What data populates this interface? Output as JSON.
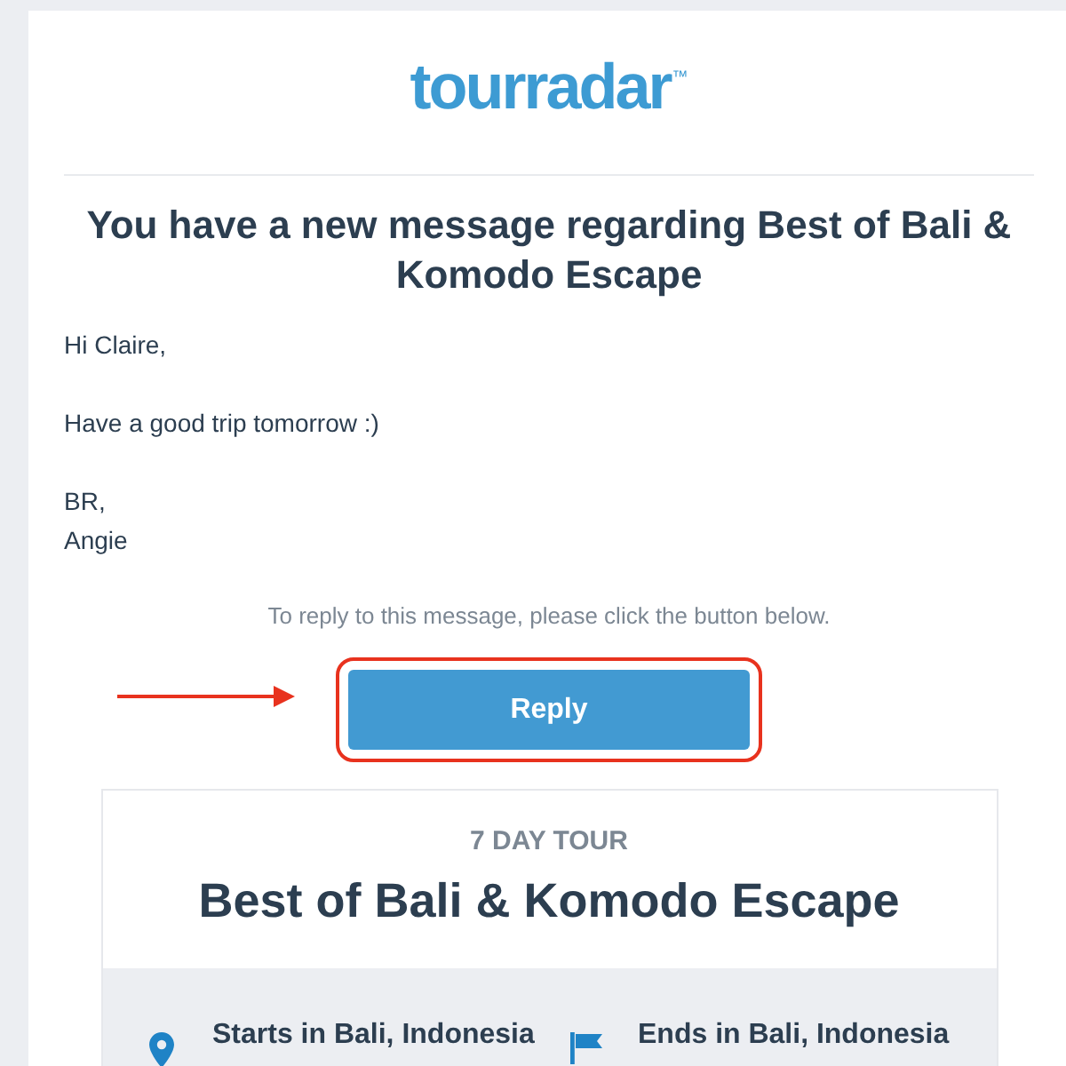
{
  "logo": {
    "wordmark": "tourradar",
    "trademark": "™"
  },
  "heading": "You have a new message regarding Best of Bali & Komodo Escape",
  "message": {
    "paragraphs": [
      [
        "Hi Claire,"
      ],
      [
        "Have a good trip tomorrow :)"
      ],
      [
        "BR,",
        "Angie"
      ]
    ]
  },
  "reply_prompt": "To reply to this message, please click the button below.",
  "reply_button": {
    "label": "Reply",
    "highlighted": true
  },
  "tour_card": {
    "duration": "7 DAY TOUR",
    "title": "Best of Bali & Komodo Escape",
    "endpoints": [
      {
        "kind": "start",
        "label": "Starts in Bali, Indonesia"
      },
      {
        "kind": "end",
        "label": "Ends in Bali, Indonesia"
      }
    ]
  }
}
